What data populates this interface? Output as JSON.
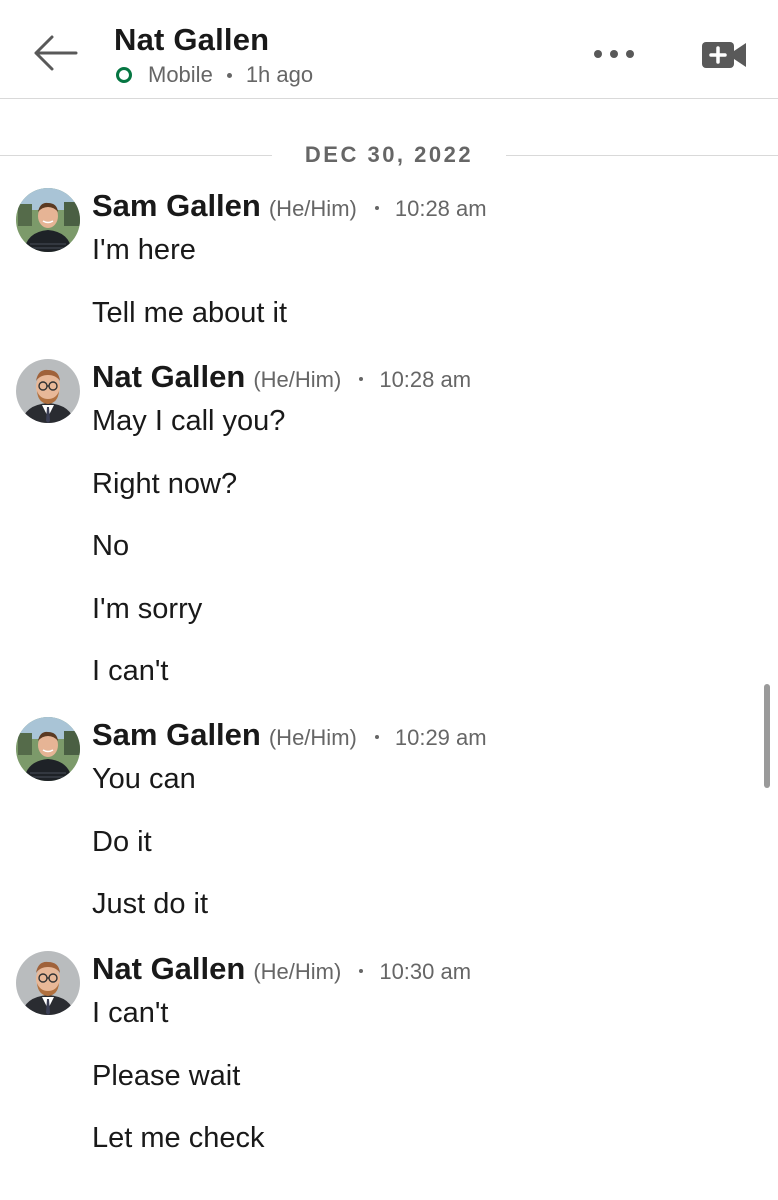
{
  "header": {
    "contact_name": "Nat Gallen",
    "status_device": "Mobile",
    "status_time": "1h ago",
    "icons": {
      "back": "arrow-left-icon",
      "more": "more-horizontal-icon",
      "video": "video-call-icon"
    },
    "online_color": "#057642"
  },
  "date_divider": "DEC 30, 2022",
  "groups": [
    {
      "sender": "Sam Gallen",
      "pronouns": "(He/Him)",
      "time": "10:28 am",
      "messages": [
        "I'm here",
        "Tell me about it"
      ]
    },
    {
      "sender": "Nat Gallen",
      "pronouns": "(He/Him)",
      "time": "10:28 am",
      "messages": [
        "May I call you?",
        "Right now?",
        "No",
        "I'm sorry",
        "I can't"
      ]
    },
    {
      "sender": "Sam Gallen",
      "pronouns": "(He/Him)",
      "time": "10:29 am",
      "messages": [
        "You can",
        "Do it",
        "Just do it"
      ]
    },
    {
      "sender": "Nat Gallen",
      "pronouns": "(He/Him)",
      "time": "10:30 am",
      "messages": [
        "I can't",
        "Please wait",
        "Let me check"
      ]
    }
  ]
}
